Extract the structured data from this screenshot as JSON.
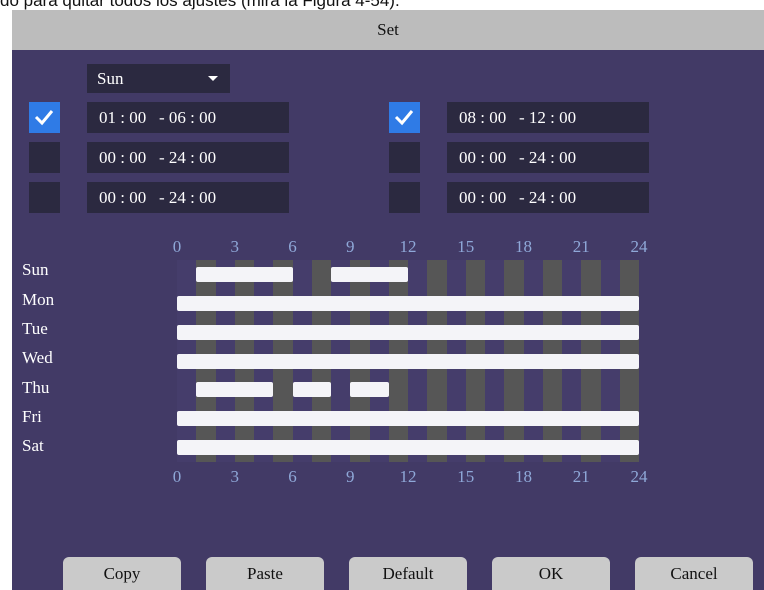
{
  "caption": "do para quitar todos los ajustes (mira la Figura 4-54).",
  "dialog_title": "Set",
  "day_select": {
    "value": "Sun"
  },
  "periods_left": [
    {
      "checked": true,
      "time": "01 : 00   - 06 : 00"
    },
    {
      "checked": false,
      "time": "00 : 00   - 24 : 00"
    },
    {
      "checked": false,
      "time": "00 : 00   - 24 : 00"
    }
  ],
  "periods_right": [
    {
      "checked": true,
      "time": "08 : 00   - 12 : 00"
    },
    {
      "checked": false,
      "time": "00 : 00   - 24 : 00"
    },
    {
      "checked": false,
      "time": "00 : 00   - 24 : 00"
    }
  ],
  "hour_scale": [
    "0",
    "3",
    "6",
    "9",
    "12",
    "15",
    "18",
    "21",
    "24"
  ],
  "days": [
    "Sun",
    "Mon",
    "Tue",
    "Wed",
    "Thu",
    "Fri",
    "Sat"
  ],
  "schedule": {
    "Sun": [
      [
        1,
        6
      ],
      [
        8,
        12
      ]
    ],
    "Mon": [
      [
        0,
        24
      ]
    ],
    "Tue": [
      [
        0,
        24
      ]
    ],
    "Wed": [
      [
        0,
        24
      ]
    ],
    "Thu": [
      [
        1,
        5
      ],
      [
        6,
        8
      ],
      [
        9,
        11
      ]
    ],
    "Fri": [
      [
        0,
        24
      ]
    ],
    "Sat": [
      [
        0,
        24
      ]
    ]
  },
  "buttons": {
    "copy": "Copy",
    "paste": "Paste",
    "default": "Default",
    "ok": "OK",
    "cancel": "Cancel"
  },
  "colors": {
    "background": "#423a66",
    "field": "#2b2940",
    "checkbox_checked": "#2f7be6",
    "scale_text": "#8fa8d8",
    "bar": "#f4f4f8",
    "stripe": "#565656"
  }
}
